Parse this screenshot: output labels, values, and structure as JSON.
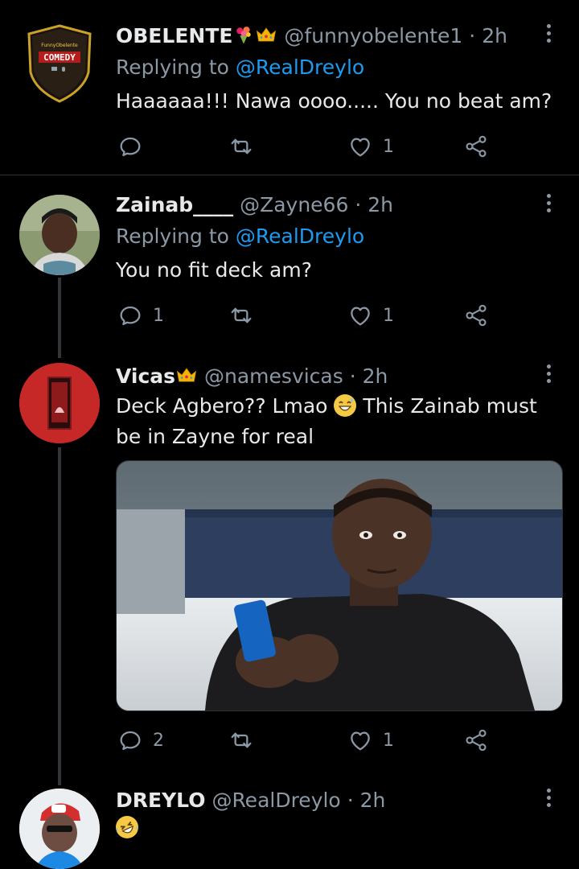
{
  "colors": {
    "background": "#000000",
    "primary_text": "#e7e9ea",
    "secondary_text": "#8b98a5",
    "link": "#1d9bf0",
    "divider": "#2f3336"
  },
  "tweets": [
    {
      "display_name": "OBELENTE",
      "name_emojis": [
        "bouquet-emoji",
        "crown-emoji"
      ],
      "handle": "@funnyobelente1",
      "separator": "·",
      "time": "2h",
      "replying_prefix": "Replying to",
      "replying_to": "@RealDreylo",
      "text": "Haaaaaa!!! Nawa oooo..... You no beat am?",
      "avatar_lettering": "COMEDY",
      "avatar_small_lettering": "FunnyObelente",
      "reply_count": "",
      "like_count": "1"
    },
    {
      "display_name": "Zainab____",
      "handle": "@Zayne66",
      "separator": "·",
      "time": "2h",
      "replying_prefix": "Replying to",
      "replying_to": "@RealDreylo",
      "text": "You no fit deck am?",
      "reply_count": "1",
      "like_count": "1"
    },
    {
      "display_name": "Vicas",
      "name_emojis": [
        "crown-emoji"
      ],
      "handle": "@namesvicas",
      "separator": "·",
      "time": "2h",
      "text_part1": "Deck Agbero?? Lmao",
      "text_emoji": "grinning-sweat-emoji",
      "text_part2": "This Zainab must be in Zayne for real",
      "media": "photo-man-in-bed-holding-phone",
      "reply_count": "2",
      "like_count": "1"
    },
    {
      "display_name": "DREYLO",
      "handle": "@RealDreylo",
      "separator": "·",
      "time": "2h",
      "text_emoji": "rolling-laughing-emoji"
    }
  ]
}
